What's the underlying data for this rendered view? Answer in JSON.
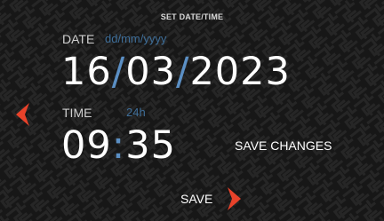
{
  "header": {
    "title": "SET DATE/TIME"
  },
  "date": {
    "label": "DATE",
    "format_hint": "dd/mm/yyyy",
    "day": "16",
    "month": "03",
    "year": "2023",
    "separator": "/"
  },
  "time": {
    "label": "TIME",
    "format_hint": "24h",
    "hours": "09",
    "minutes": "35",
    "separator": ":"
  },
  "actions": {
    "save_changes_label": "SAVE CHANGES",
    "save_label": "SAVE"
  },
  "icons": {
    "back": "chevron-left-icon",
    "save": "chevron-right-icon"
  },
  "colors": {
    "accent_arrow": "#e8422a",
    "separator_blue": "#5b8fc4",
    "hint_blue": "#3e6e99",
    "background": "#171717"
  }
}
